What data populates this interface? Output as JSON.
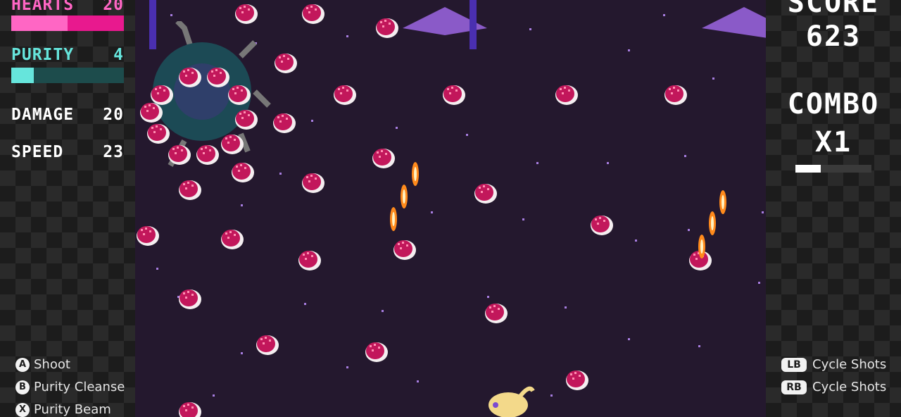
{
  "stats": {
    "hearts": {
      "label": "HEARTS",
      "value": "20",
      "fill": 0.5
    },
    "purity": {
      "label": "PURITY",
      "value": "4",
      "fill": 0.2
    },
    "damage": {
      "label": "DAMAGE",
      "value": "20"
    },
    "speed": {
      "label": "SPEED",
      "value": "23"
    }
  },
  "score": {
    "label": "SCORE",
    "value": "623"
  },
  "combo": {
    "label": "COMBO",
    "value": "X1",
    "fill": 0.33
  },
  "controls_left": [
    {
      "button": "A",
      "label": "Shoot"
    },
    {
      "button": "B",
      "label": "Purity Cleanse"
    },
    {
      "button": "X",
      "label": "Purity Beam"
    }
  ],
  "controls_right": [
    {
      "button": "LB",
      "label": "Cycle Shots"
    },
    {
      "button": "RB",
      "label": "Cycle Shots"
    }
  ],
  "colors": {
    "hearts": "#ff66c4",
    "hearts_rest": "#e8198e",
    "purity": "#66e5dc",
    "purity_rest": "#1d4c4c",
    "combo": "#ffffff",
    "combo_rest": "#3a3a3a",
    "playfield": "#24182e",
    "enemy": "#c2175b",
    "bullet": "#ff8a1c"
  }
}
